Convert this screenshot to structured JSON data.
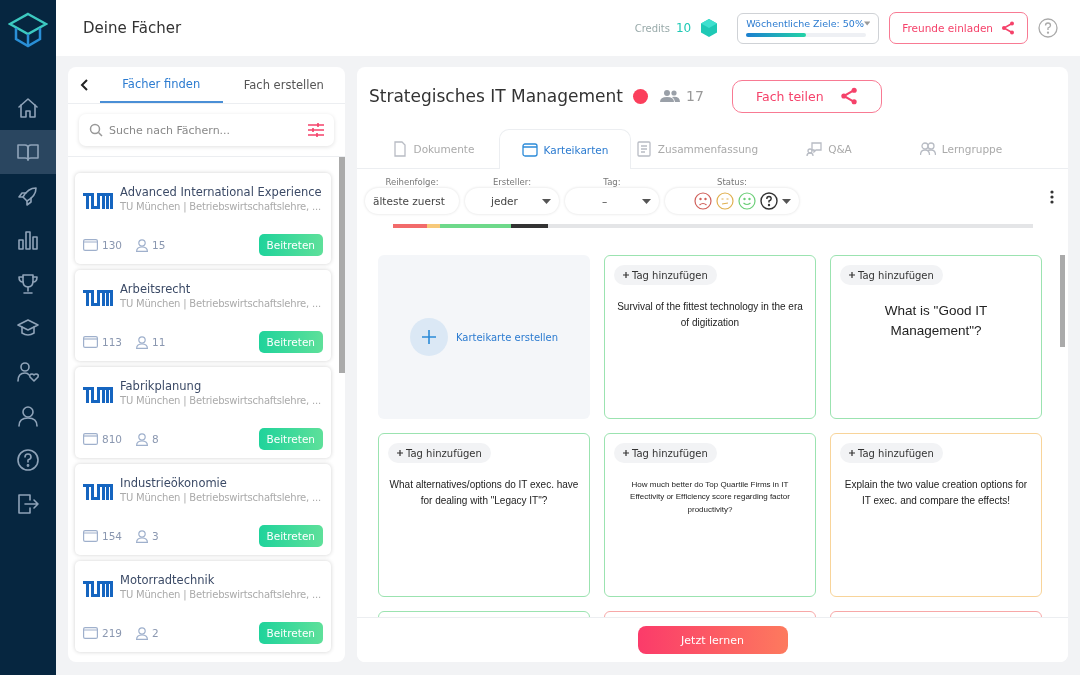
{
  "sidebar": {
    "items": [
      {
        "kind": "home",
        "selected": false
      },
      {
        "kind": "book",
        "selected": true
      },
      {
        "kind": "rocket",
        "selected": false
      },
      {
        "kind": "chart",
        "selected": false
      },
      {
        "kind": "trophy",
        "selected": false
      },
      {
        "kind": "cap",
        "selected": false
      },
      {
        "kind": "friends",
        "selected": false
      },
      {
        "kind": "profile",
        "selected": false
      },
      {
        "kind": "help",
        "selected": false
      },
      {
        "kind": "logout",
        "selected": false
      }
    ]
  },
  "header": {
    "title": "Deine Fächer",
    "credits_label": "Credits",
    "credits": "10",
    "goal": {
      "label": "Wöchentliche Ziele: 50%",
      "level": 0.5
    },
    "invite_button": "Freunde einladen"
  },
  "left_panel": {
    "tabs": [
      {
        "label": "Fächer finden",
        "selected": true
      },
      {
        "label": "Fach erstellen",
        "selected": false
      }
    ],
    "search": {
      "placeholder": "Suche nach Fächern..."
    },
    "courses": [
      {
        "name": "Advanced International Experience",
        "meta": "TU München | Betriebswirtschaftslehre, ...",
        "cards": "130",
        "members": "15",
        "button": "Beitreten"
      },
      {
        "name": "Arbeitsrecht",
        "meta": "TU München | Betriebswirtschaftslehre, ...",
        "cards": "113",
        "members": "11",
        "button": "Beitreten"
      },
      {
        "name": "Fabrikplanung",
        "meta": "TU München | Betriebswirtschaftslehre, ...",
        "cards": "810",
        "members": "8",
        "button": "Beitreten"
      },
      {
        "name": "Industrieökonomie",
        "meta": "TU München | Betriebswirtschaftslehre, ...",
        "cards": "154",
        "members": "3",
        "button": "Beitreten"
      },
      {
        "name": "Motorradtechnik",
        "meta": "TU München | Betriebswirtschaftslehre, ...",
        "cards": "219",
        "members": "2",
        "button": "Beitreten"
      }
    ]
  },
  "subject": {
    "title": "Strategisches IT Management",
    "color": "#fb3f5c",
    "members": "17",
    "share_button": "Fach teilen",
    "tabs": [
      {
        "label": "Dokumente",
        "kind": "document",
        "selected": false
      },
      {
        "label": "Karteikarten",
        "kind": "cards",
        "selected": true
      },
      {
        "label": "Zusammenfassung",
        "kind": "summary",
        "selected": false
      },
      {
        "label": "Q&A",
        "kind": "qa",
        "selected": false
      },
      {
        "label": "Lerngruppe",
        "kind": "group",
        "selected": false
      }
    ],
    "filters": [
      {
        "label": "Reihenfolge:",
        "value": "älteste zuerst"
      },
      {
        "label": "Ersteller:",
        "value": "jeder"
      },
      {
        "label": "Tag:",
        "value": "–"
      }
    ],
    "status_filter": {
      "label": "Status:"
    },
    "create_card": "Karteikarte erstellen",
    "flashcards": [
      {
        "tag": "Tag hinzufügen",
        "question": "Survival of the fittest technology in the era of digitization",
        "kind": "normal",
        "color": "#9be3b0"
      },
      {
        "tag": "Tag hinzufügen",
        "question": "What is \"Good IT Management\"?",
        "kind": "large",
        "color": "#9be3b0"
      },
      {
        "tag": "Tag hinzufügen",
        "question": "What alternatives/options do IT exec. have for dealing with \"Legacy IT\"?",
        "kind": "normal",
        "color": "#9be3b0"
      },
      {
        "tag": "Tag hinzufügen",
        "question": "How much better do Top Quartile Firms in IT Effectivity or Efficiency score regarding factor productivity?",
        "kind": "small",
        "color": "#9be3b0"
      },
      {
        "tag": "Tag hinzufügen",
        "question": "Explain the two value creation options for IT exec. and compare the effects!",
        "kind": "normal",
        "color": "#f8d49a"
      },
      {
        "color": "#9be3b0"
      },
      {
        "color": "#f7a8a8"
      },
      {
        "color": "#f7a8a8"
      }
    ],
    "learn_button": "Jetzt lernen"
  }
}
